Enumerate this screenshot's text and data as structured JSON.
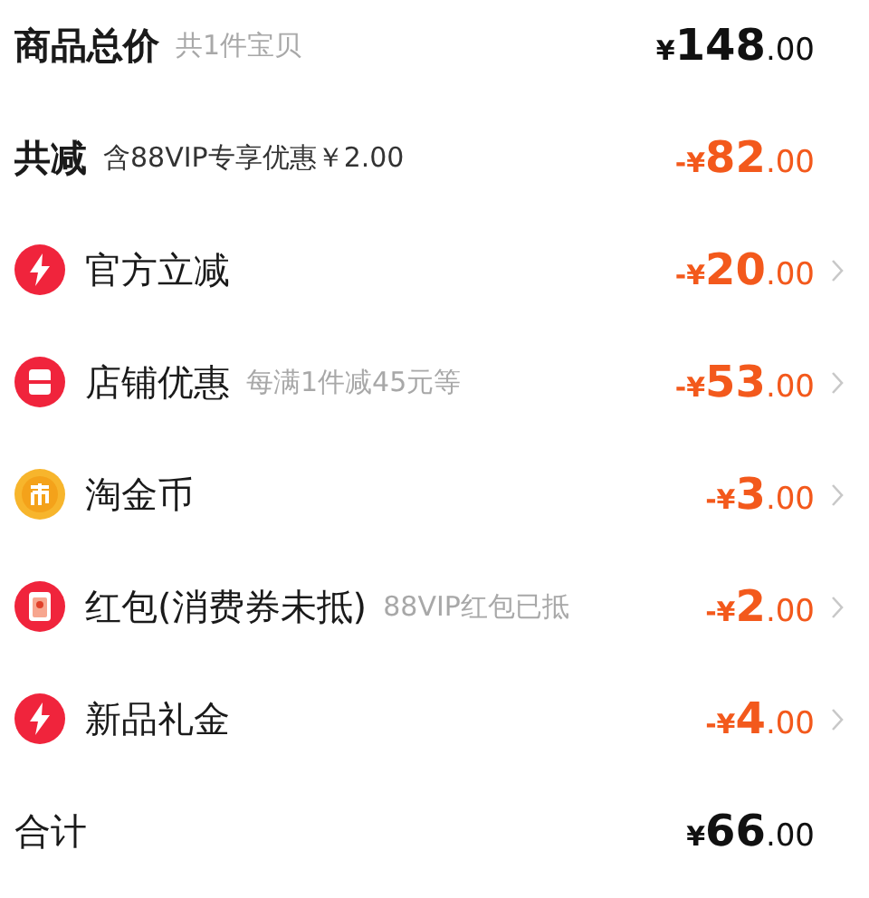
{
  "rows": [
    {
      "kind": "summary",
      "title": "商品总价",
      "note": "共1件宝贝",
      "price": {
        "prefix": "¥",
        "amount": "148",
        "cents": ".00"
      }
    },
    {
      "kind": "savings",
      "title": "共减",
      "note": "含88VIP专享优惠￥2.00",
      "price": {
        "prefix": "-¥",
        "amount": "82",
        "cents": ".00"
      }
    },
    {
      "kind": "instant",
      "title": "官方立减",
      "price": {
        "prefix": "-¥",
        "amount": "20",
        "cents": ".00"
      }
    },
    {
      "kind": "store",
      "title": "店铺优惠",
      "note": "每满1件减45元等",
      "price": {
        "prefix": "-¥",
        "amount": "53",
        "cents": ".00"
      }
    },
    {
      "kind": "coin",
      "title": "淘金币",
      "price": {
        "prefix": "-¥",
        "amount": "3",
        "cents": ".00"
      }
    },
    {
      "kind": "packet",
      "title": "红包(消费券未抵)",
      "note": "88VIP红包已抵",
      "price": {
        "prefix": "-¥",
        "amount": "2",
        "cents": ".00"
      }
    },
    {
      "kind": "instant",
      "title": "新品礼金",
      "price": {
        "prefix": "-¥",
        "amount": "4",
        "cents": ".00"
      }
    },
    {
      "kind": "total",
      "title": "合计",
      "price": {
        "prefix": "¥",
        "amount": "66",
        "cents": ".00"
      }
    }
  ]
}
